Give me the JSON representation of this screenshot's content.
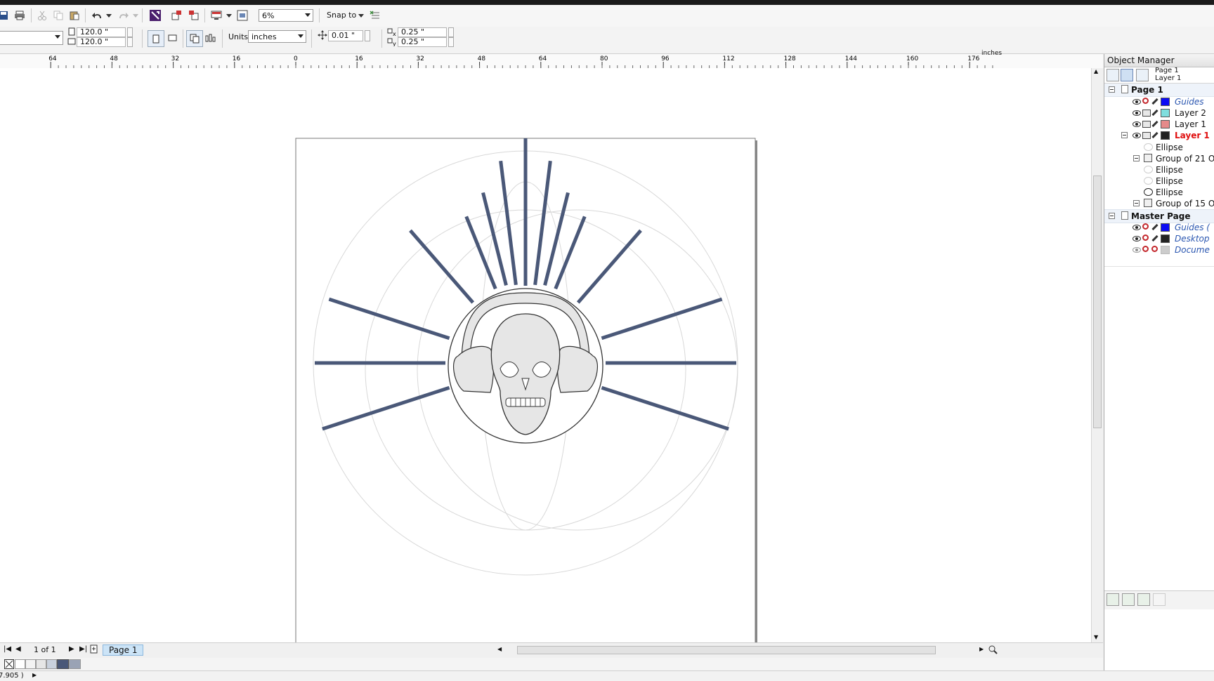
{
  "toolbar": {
    "zoom_value": "6%",
    "snap_label": "Snap to"
  },
  "property_bar": {
    "width_value": "120.0 \"",
    "height_value": "120.0 \"",
    "units_label": "Units:",
    "units_value": "inches",
    "nudge_value": "0.01 \"",
    "dup_x_value": "0.25 \"",
    "dup_y_value": "0.25 \""
  },
  "ruler": {
    "ticks": [
      "64",
      "48",
      "32",
      "16",
      "0",
      "16",
      "32",
      "48",
      "64",
      "80",
      "96",
      "112",
      "128",
      "144",
      "160",
      "176"
    ],
    "unit": "inches"
  },
  "page_nav": {
    "counter": "1 of 1",
    "tab_label": "Page 1"
  },
  "status": {
    "coords": "7.905 )"
  },
  "object_manager": {
    "title": "Object Manager",
    "header_page": "Page 1",
    "header_layer": "Layer 1",
    "page1_label": "Page 1",
    "layers": [
      {
        "label": "Guides",
        "color": "#0b0bf5"
      },
      {
        "label": "Layer 2",
        "color": "#7fdede"
      },
      {
        "label": "Layer 1",
        "color": "#e58a8a"
      },
      {
        "label": "Layer 1",
        "color": "#222222"
      }
    ],
    "objects": [
      "Ellipse",
      "Group of 21 O",
      "Ellipse",
      "Ellipse",
      "Ellipse",
      "Group of 15 O"
    ],
    "master_label": "Master Page",
    "master_layers": [
      {
        "label": "Guides (",
        "color": "#0b0bf5"
      },
      {
        "label": "Desktop",
        "color": "#222222"
      },
      {
        "label": "Docume",
        "color": "#cccccc"
      }
    ]
  },
  "colors": {
    "ray": "#4a5878",
    "skull_fill": "#e6e6e6",
    "guide_circle": "#d6d6d6"
  }
}
